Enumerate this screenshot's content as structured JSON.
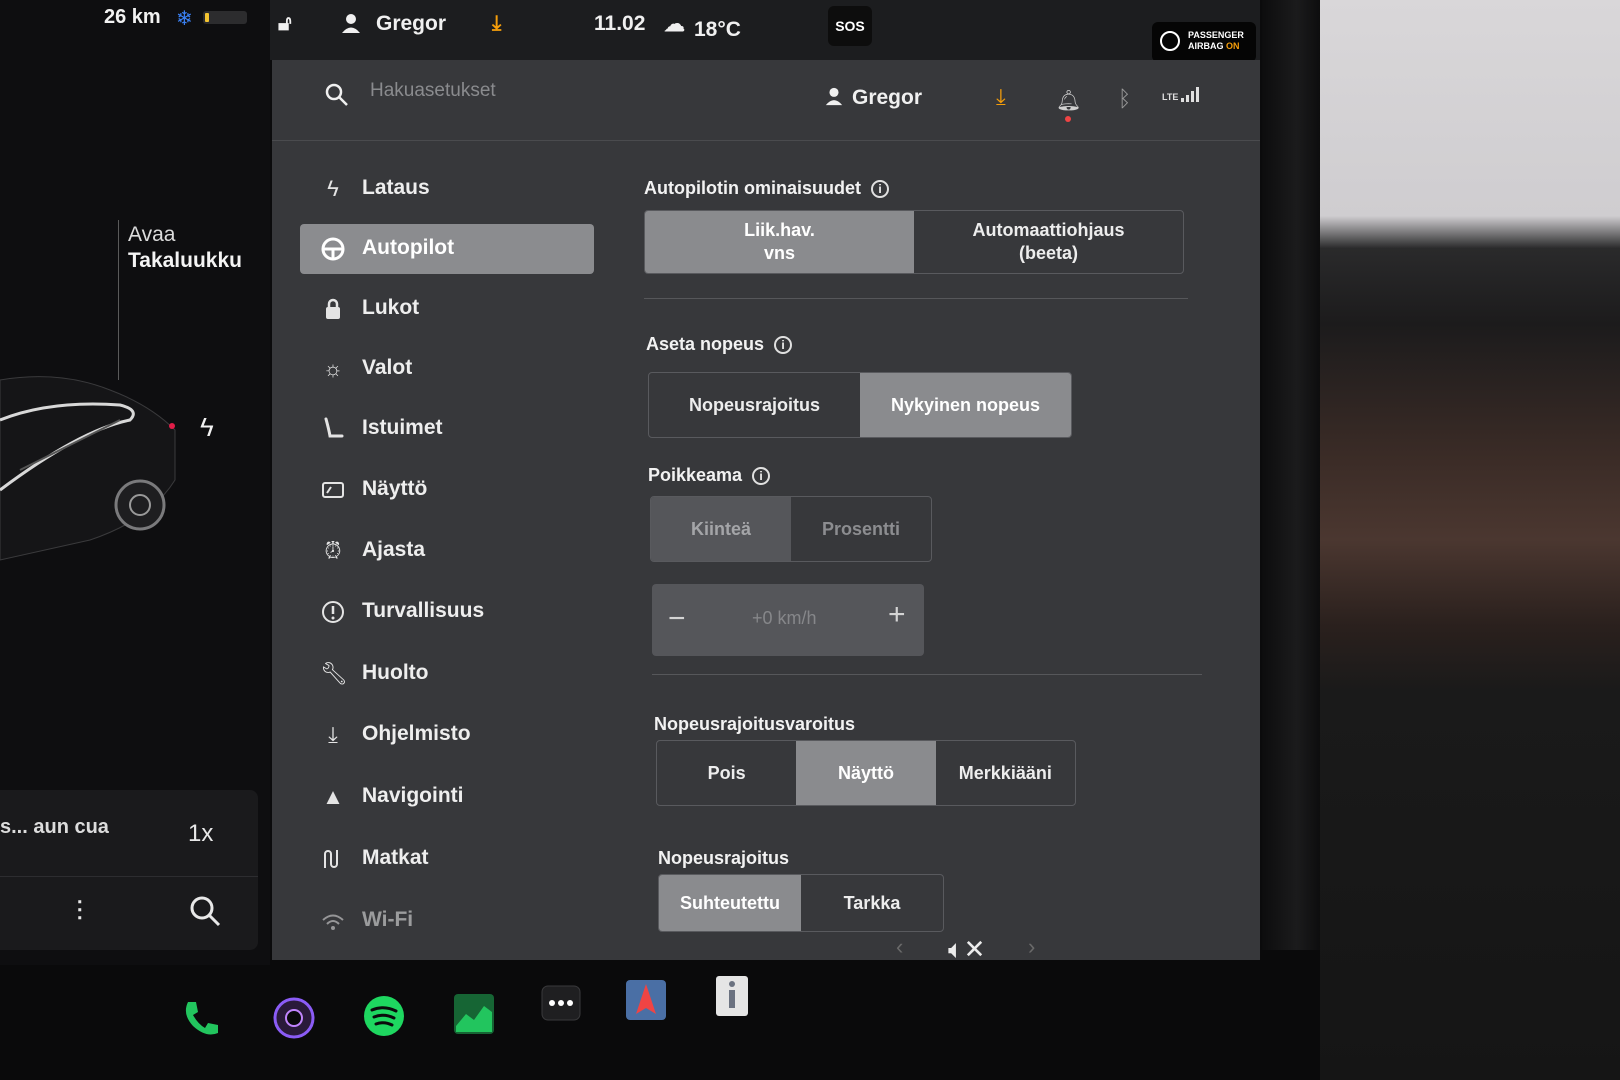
{
  "left_panel": {
    "range": "26 km",
    "trunk_action": "Avaa",
    "trunk_label": "Takaluukku",
    "media": {
      "title": "s... aun cua",
      "speed": "1x"
    }
  },
  "status_bar": {
    "user": "Gregor",
    "sos": "SOS",
    "time": "11.02",
    "temperature": "18°C",
    "airbag_line1": "PASSENGER",
    "airbag_line2_a": "AIRBAG",
    "airbag_line2_b": "ON"
  },
  "header": {
    "search_placeholder": "Hakuasetukset",
    "user": "Gregor",
    "signal": "LTE"
  },
  "sidebar": {
    "items": [
      {
        "label": "Lataus",
        "icon": "bolt-icon"
      },
      {
        "label": "Autopilot",
        "icon": "steering-wheel-icon",
        "active": true
      },
      {
        "label": "Lukot",
        "icon": "lock-icon"
      },
      {
        "label": "Valot",
        "icon": "light-icon"
      },
      {
        "label": "Istuimet",
        "icon": "seat-icon"
      },
      {
        "label": "Näyttö",
        "icon": "display-icon"
      },
      {
        "label": "Ajasta",
        "icon": "alarm-clock-icon"
      },
      {
        "label": "Turvallisuus",
        "icon": "safety-icon"
      },
      {
        "label": "Huolto",
        "icon": "wrench-icon"
      },
      {
        "label": "Ohjelmisto",
        "icon": "download-icon"
      },
      {
        "label": "Navigointi",
        "icon": "navigation-icon"
      },
      {
        "label": "Matkat",
        "icon": "trips-icon"
      },
      {
        "label": "Wi-Fi",
        "icon": "wifi-icon"
      }
    ]
  },
  "settings": {
    "autopilot_features": {
      "title": "Autopilotin ominaisuudet",
      "options": [
        "Liik.hav. vns",
        "Automaattiohjaus (beeta)"
      ],
      "option0_line1": "Liik.hav.",
      "option0_line2": "vns",
      "option1_line1": "Automaattiohjaus",
      "option1_line2": "(beeta)",
      "selected": 0
    },
    "set_speed": {
      "title": "Aseta nopeus",
      "options": [
        "Nopeusrajoitus",
        "Nykyinen nopeus"
      ],
      "selected": 1
    },
    "offset": {
      "title": "Poikkeama",
      "options": [
        "Kiinteä",
        "Prosentti"
      ],
      "selected": 0,
      "value": "+0 km/h"
    },
    "speed_limit_warning": {
      "title": "Nopeusrajoitusvaroitus",
      "options": [
        "Pois",
        "Näyttö",
        "Merkkiääni"
      ],
      "selected": 1
    },
    "speed_limit": {
      "title": "Nopeusrajoitus",
      "options": [
        "Suhteutettu",
        "Tarkka"
      ],
      "selected": 0
    }
  },
  "dock": {
    "apps": [
      "phone-icon",
      "camera-icon",
      "spotify-icon",
      "stocks-icon",
      "more-icon",
      "navigation-app-icon",
      "release-notes-icon"
    ]
  },
  "colors": {
    "accent_download": "#f59e0b",
    "bluetooth": "#9a9a9a",
    "snowflake": "#3b82f6",
    "panel_bg": "#37383b",
    "selected_segment": "#8a8b8e"
  }
}
